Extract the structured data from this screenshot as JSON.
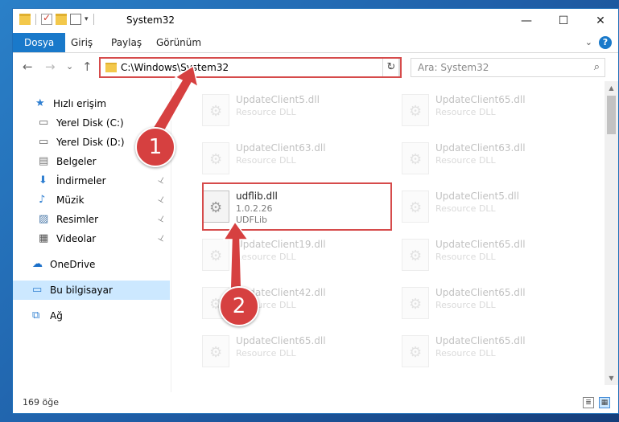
{
  "window": {
    "title": "System32",
    "controls": {
      "minimize": "—",
      "maximize": "☐",
      "close": "✕"
    }
  },
  "ribbon": {
    "tabs": [
      "Dosya",
      "Giriş",
      "Paylaş",
      "Görünüm"
    ],
    "help": "?"
  },
  "nav": {
    "back": "←",
    "forward": "→",
    "recent": "⌄",
    "up": "↑",
    "address": "C:\\Windows\\System32",
    "refresh": "↻",
    "search_placeholder": "Ara: System32",
    "search_icon": "⌕"
  },
  "sidebar": {
    "items": [
      {
        "label": "Hızlı erişim",
        "icon": "star-icon",
        "glyph": "★",
        "color": "#2f7fd1"
      },
      {
        "label": "Yerel Disk (C:)",
        "icon": "drive-icon",
        "glyph": "▭",
        "color": "#666666"
      },
      {
        "label": "Yerel Disk (D:)",
        "icon": "drive-icon",
        "glyph": "▭",
        "color": "#666666"
      },
      {
        "label": "Belgeler",
        "icon": "documents-icon",
        "glyph": "▤",
        "color": "#777777"
      },
      {
        "label": "İndirmeler",
        "icon": "download-icon",
        "glyph": "⬇",
        "color": "#2f7fd1"
      },
      {
        "label": "Müzik",
        "icon": "music-icon",
        "glyph": "♪",
        "color": "#2f7fd1"
      },
      {
        "label": "Resimler",
        "icon": "pictures-icon",
        "glyph": "▨",
        "color": "#4a78a8"
      },
      {
        "label": "Videolar",
        "icon": "videos-icon",
        "glyph": "▦",
        "color": "#555555"
      },
      {
        "label": "OneDrive",
        "icon": "cloud-icon",
        "glyph": "☁",
        "color": "#1a6fc9"
      },
      {
        "label": "Bu bilgisayar",
        "icon": "computer-icon",
        "glyph": "▭",
        "color": "#2f7fd1"
      },
      {
        "label": "Ağ",
        "icon": "network-icon",
        "glyph": "⧉",
        "color": "#2f7fd1"
      }
    ],
    "pin": "📌"
  },
  "files": [
    {
      "name": "UpdateClient5.dll",
      "sub": "Resource DLL"
    },
    {
      "name": "UpdateClient65.dll",
      "sub": "Resource DLL"
    },
    {
      "name": "UpdateClient63.dll",
      "sub": "Resource DLL"
    },
    {
      "name": "UpdateClient63.dll",
      "sub": "Resource DLL"
    },
    {
      "name": "udflib.dll",
      "version": "1.0.2.26",
      "sub": "UDFLib"
    },
    {
      "name": "UpdateClient5.dll",
      "sub": "Resource DLL"
    },
    {
      "name": "UpdateClient19.dll",
      "sub": "Resource DLL"
    },
    {
      "name": "UpdateClient65.dll",
      "sub": "Resource DLL"
    },
    {
      "name": "UpdateClient42.dll",
      "sub": "Resource DLL"
    },
    {
      "name": "UpdateClient65.dll",
      "sub": "Resource DLL"
    },
    {
      "name": "UpdateClient65.dll",
      "sub": "Resource DLL"
    },
    {
      "name": "UpdateClient65.dll",
      "sub": "Resource DLL"
    }
  ],
  "status": {
    "count": "169 öğe"
  },
  "callouts": [
    "1",
    "2"
  ],
  "colors": {
    "accent": "#1979ca",
    "highlight": "#d64b4b"
  }
}
